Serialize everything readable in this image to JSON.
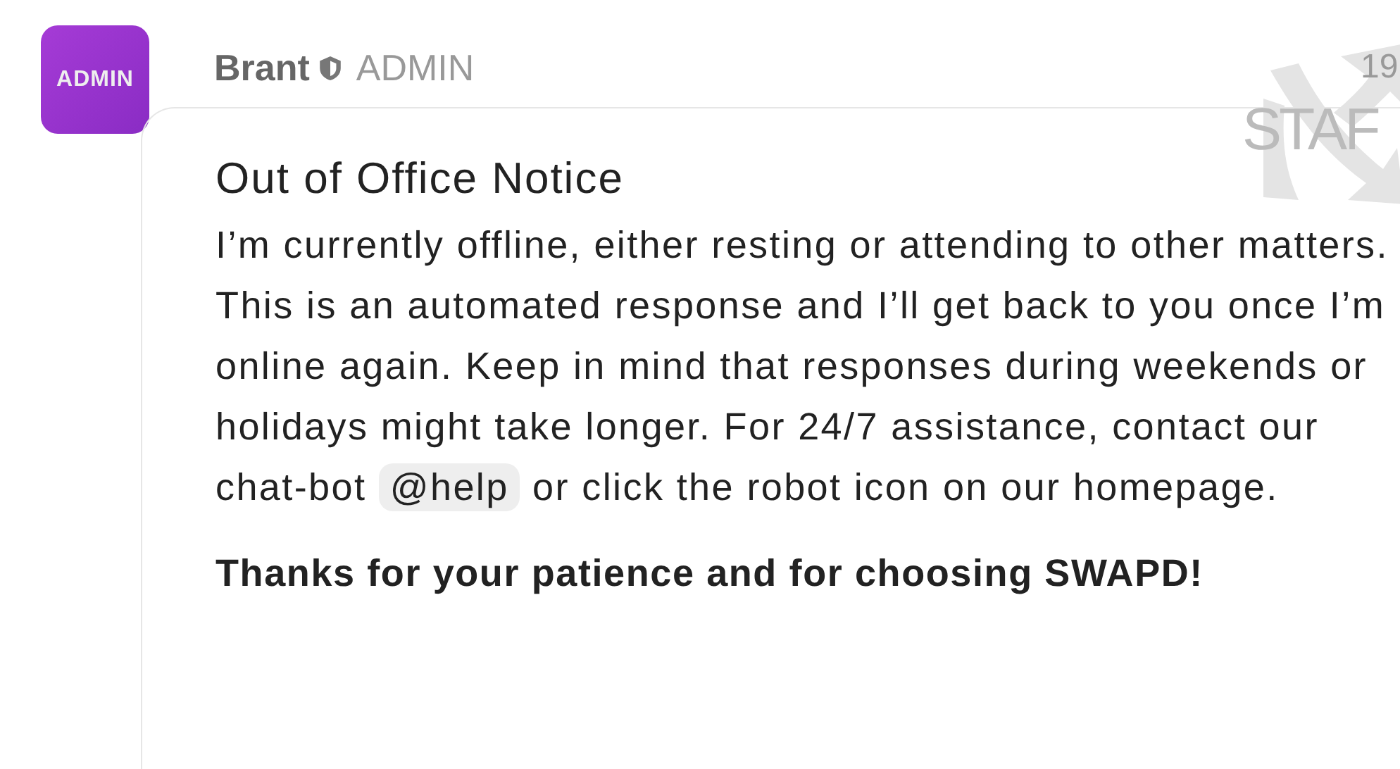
{
  "post": {
    "avatar_label": "ADMIN",
    "author": "Brant",
    "role": "ADMIN",
    "time": "19",
    "badge": "STAF"
  },
  "message": {
    "title": "Out of Office Notice",
    "body_before": "I’m currently offline, either resting or attending to other matters. This is an automated response and I’ll get back to you once I’m online again. Keep in mind that responses during weekends or holidays might take longer. For 24/7 assistance, contact our chat-bot",
    "mention": "@help",
    "body_after": "or click the robot icon on our homepage.",
    "closing": "Thanks for your patience and for choosing SWAPD!"
  }
}
